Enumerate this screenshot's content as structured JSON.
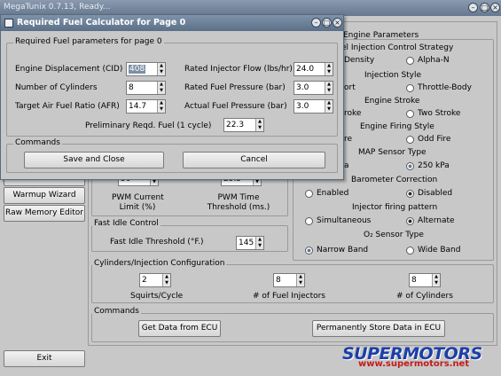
{
  "main_window": {
    "title": "MegaTunix 0.7.13,  Ready...",
    "controls": {
      "minimize": "–",
      "maximize": "□",
      "close": "×"
    }
  },
  "sidebar": {
    "partial_item": "...s",
    "items": [
      {
        "label": "Warmup Wizard"
      },
      {
        "label": "Raw Memory Editor"
      }
    ],
    "exit_label": "Exit"
  },
  "right_panel": {
    "engine_parameters": {
      "title": "Engine Parameters",
      "injection_control": {
        "title": "el Injection Control Strategy",
        "options": [
          "Density",
          "Alpha-N"
        ],
        "selected": 0
      },
      "injection_style": {
        "title": "Injection Style",
        "options": [
          "ort",
          "Throttle-Body"
        ],
        "selected": 0
      },
      "engine_stroke": {
        "title": "Engine Stroke",
        "options": [
          "roke",
          "Two Stroke"
        ],
        "selected": 0
      },
      "engine_firing_style": {
        "title": "Engine Firing Style",
        "options": [
          "re",
          "Odd Fire"
        ],
        "selected": 0
      },
      "map_sensor": {
        "title": "MAP Sensor Type",
        "options": [
          "a",
          "250 kPa"
        ],
        "selected": 1
      },
      "barometer": {
        "title": "Barometer Correction",
        "options": [
          "Enabled",
          "Disabled"
        ],
        "selected": 1
      },
      "injector_firing": {
        "title": "Injector firing pattern",
        "options": [
          "Simultaneous",
          "Alternate"
        ],
        "selected": 1
      },
      "o2_sensor": {
        "title": "O₂ Sensor Type",
        "options": [
          "Narrow Band",
          "Wide Band"
        ],
        "selected": 0
      }
    }
  },
  "pwm": {
    "current_limit_value": "50",
    "time_threshold_value": "25.5",
    "current_limit_label": "PWM Current\nLimit (%)",
    "time_threshold_label": "PWM Time\nThreshold (ms.)"
  },
  "fast_idle": {
    "title": "Fast Idle Control",
    "label": "Fast Idle Threshold (°F.)",
    "value": "145"
  },
  "cyl_inj": {
    "title": "Cylinders/Injection Configuration",
    "fields": [
      {
        "label": "Squirts/Cycle",
        "value": "2"
      },
      {
        "label": "# of Fuel Injectors",
        "value": "8"
      },
      {
        "label": "# of Cylinders",
        "value": "8"
      }
    ]
  },
  "main_commands": {
    "title": "Commands",
    "get_data_label": "Get Data from ECU",
    "store_label": "Permanently Store Data in ECU"
  },
  "dialog": {
    "title": "Required Fuel Calculator for Page 0",
    "params_title": "Required Fuel parameters for page 0",
    "fields": {
      "engine_displacement": {
        "label": "Engine Displacement (CID)",
        "value": "408"
      },
      "num_cylinders": {
        "label": "Number of Cylinders",
        "value": "8"
      },
      "target_afr": {
        "label": "Target Air Fuel Ratio (AFR)",
        "value": "14.7"
      },
      "injector_flow": {
        "label": "Rated Injector Flow (lbs/hr)",
        "value": "24.0"
      },
      "fuel_pressure": {
        "label": "Rated Fuel Pressure (bar)",
        "value": "3.0"
      },
      "actual_pressure": {
        "label": "Actual Fuel Pressure (bar)",
        "value": "3.0"
      }
    },
    "prelim_label": "Preliminary Reqd. Fuel (1 cycle)",
    "prelim_value": "22.3",
    "commands_title": "Commands",
    "save_label": "Save and Close",
    "cancel_label": "Cancel"
  },
  "watermark": {
    "brand": "SUPERMOTORS",
    "url": "www.supermotors.net"
  },
  "colors": {
    "window_bg": "#c8c8c8",
    "titlebar": "#66788f",
    "watermark_blue": "#1c3fa8",
    "watermark_red": "#c41a1a"
  }
}
